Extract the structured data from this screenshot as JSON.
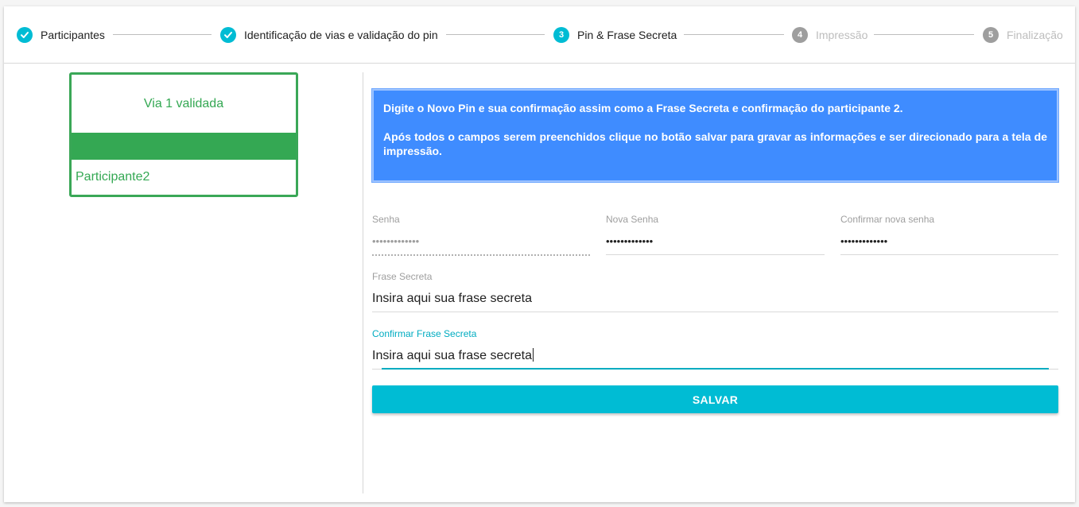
{
  "stepper": {
    "steps": [
      {
        "number": "1",
        "label": "Participantes",
        "state": "done",
        "icon": "check-icon"
      },
      {
        "number": "2",
        "label": "Identificação de vias e validação do pin",
        "state": "done",
        "icon": "check-icon"
      },
      {
        "number": "3",
        "label": "Pin & Frase Secreta",
        "state": "active"
      },
      {
        "number": "4",
        "label": "Impressão",
        "state": "pending"
      },
      {
        "number": "5",
        "label": "Finalização",
        "state": "pending"
      }
    ]
  },
  "via": {
    "title": "Via 1 validada",
    "participant": "Participante2"
  },
  "info": {
    "line1": "Digite o Novo Pin e sua confirmação assim como a Frase Secreta e confirmação do participante 2.",
    "line2": "Após todos o campos serem preenchidos clique no botão salvar para gravar as informações e ser direcionado para a tela de impressão."
  },
  "form": {
    "senha": {
      "label": "Senha",
      "value": "•••••••••••••"
    },
    "nova_senha": {
      "label": "Nova Senha",
      "value": "•••••••••••••"
    },
    "confirmar_senha": {
      "label": "Confirmar nova senha",
      "value": "•••••••••••••"
    },
    "frase": {
      "label": "Frase Secreta",
      "value": "Insira aqui sua frase secreta"
    },
    "confirmar_frase": {
      "label": "Confirmar Frase Secreta",
      "value": "Insira aqui sua frase secreta"
    },
    "save_label": "SALVAR"
  },
  "colors": {
    "accent": "#00bcd4",
    "success": "#34a853",
    "info_bg": "#3f8cff",
    "pending": "#9e9e9e"
  }
}
